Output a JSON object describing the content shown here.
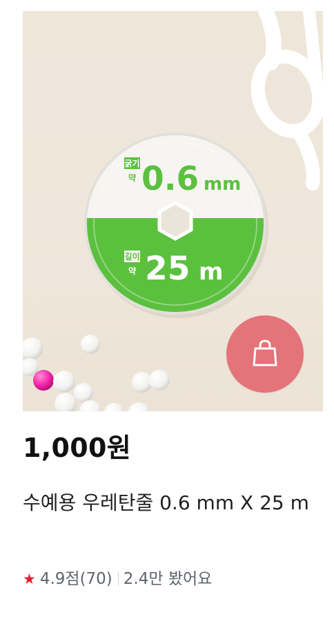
{
  "product": {
    "image_texts": {
      "thickness_label": "굵기",
      "approx_label": "약",
      "thickness_value": "0.6",
      "thickness_unit": "mm",
      "length_label": "길이",
      "length_value": "25",
      "length_unit": "m"
    },
    "price": "1,000원",
    "title": "수예용 우레탄줄 0.6 mm X 25 m",
    "rating": "4.9점(70)",
    "views": "2.4만 봤어요",
    "icons": {
      "cart": "shopping-bag-icon",
      "rating": "star-icon"
    },
    "colors": {
      "cart_button": "#e4737a",
      "star": "#e31c2b",
      "spool_green": "#5cc03f"
    }
  }
}
